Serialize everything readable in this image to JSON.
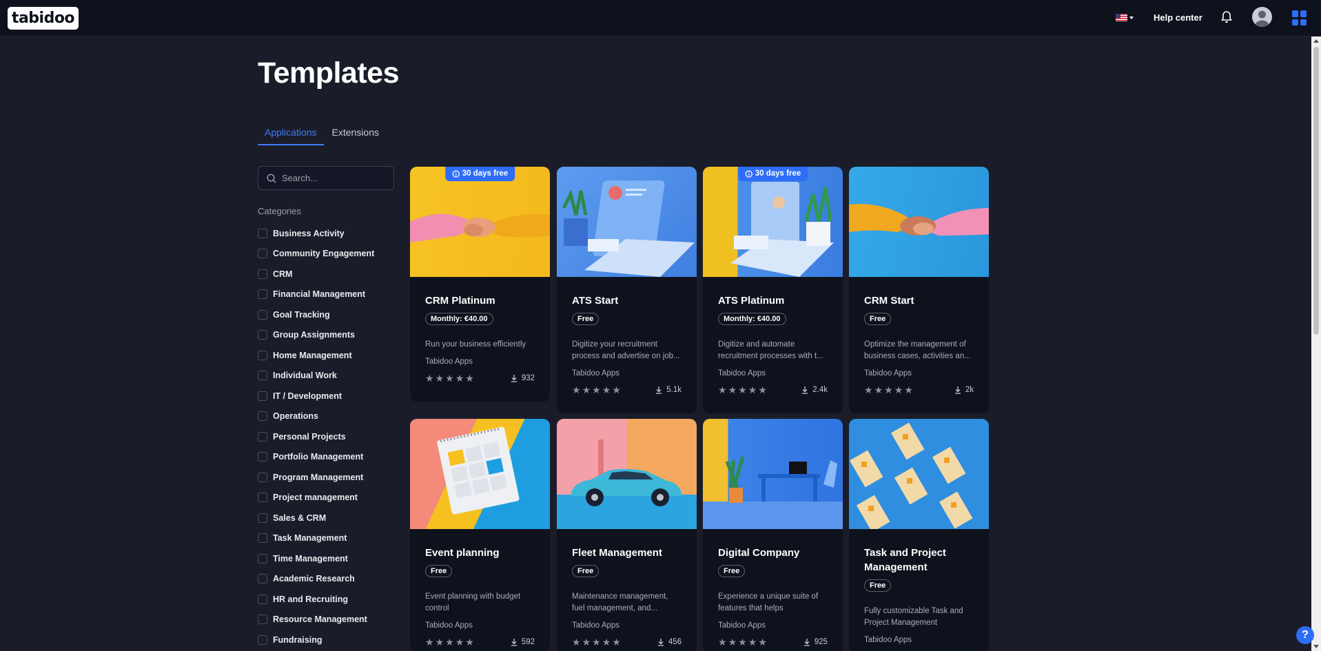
{
  "header": {
    "logo": "tabidoo",
    "help_center": "Help center"
  },
  "page": {
    "title": "Templates",
    "tabs": [
      "Applications",
      "Extensions"
    ]
  },
  "search": {
    "placeholder": "Search..."
  },
  "categories": {
    "title": "Categories",
    "items": [
      "Business Activity",
      "Community Engagement",
      "CRM",
      "Financial Management",
      "Goal Tracking",
      "Group Assignments",
      "Home Management",
      "Individual Work",
      "IT / Development",
      "Operations",
      "Personal Projects",
      "Portfolio Management",
      "Program Management",
      "Project management",
      "Sales & CRM",
      "Task Management",
      "Time Management",
      "Academic Research",
      "HR and Recruiting",
      "Resource Management",
      "Fundraising"
    ]
  },
  "cards": [
    {
      "title": "CRM Platinum",
      "price": "Monthly: €40.00",
      "description": "Run your business efficiently",
      "author": "Tabidoo Apps",
      "downloads": "932",
      "badge": "30 days free"
    },
    {
      "title": "ATS Start",
      "price": "Free",
      "description": "Digitize your recruitment process and advertise on job...",
      "author": "Tabidoo Apps",
      "downloads": "5.1k",
      "badge": ""
    },
    {
      "title": "ATS Platinum",
      "price": "Monthly: €40.00",
      "description": "Digitize and automate recruitment processes with t...",
      "author": "Tabidoo Apps",
      "downloads": "2.4k",
      "badge": "30 days free"
    },
    {
      "title": "CRM Start",
      "price": "Free",
      "description": "Optimize the management of business cases, activities an...",
      "author": "Tabidoo Apps",
      "downloads": "2k",
      "badge": ""
    },
    {
      "title": "Event planning",
      "price": "Free",
      "description": "Event planning with budget control",
      "author": "Tabidoo Apps",
      "downloads": "592",
      "badge": ""
    },
    {
      "title": "Fleet Management",
      "price": "Free",
      "description": "Maintenance management, fuel management, and...",
      "author": "Tabidoo Apps",
      "downloads": "456",
      "badge": ""
    },
    {
      "title": "Digital Company",
      "price": "Free",
      "description": "Experience a unique suite of features that helps businesse...",
      "author": "Tabidoo Apps",
      "downloads": "925",
      "badge": ""
    },
    {
      "title": "Task and Project Management",
      "price": "Free",
      "description": "Fully customizable Task and Project Management",
      "author": "Tabidoo Apps",
      "downloads": "",
      "badge": ""
    }
  ],
  "help_fab": "?"
}
